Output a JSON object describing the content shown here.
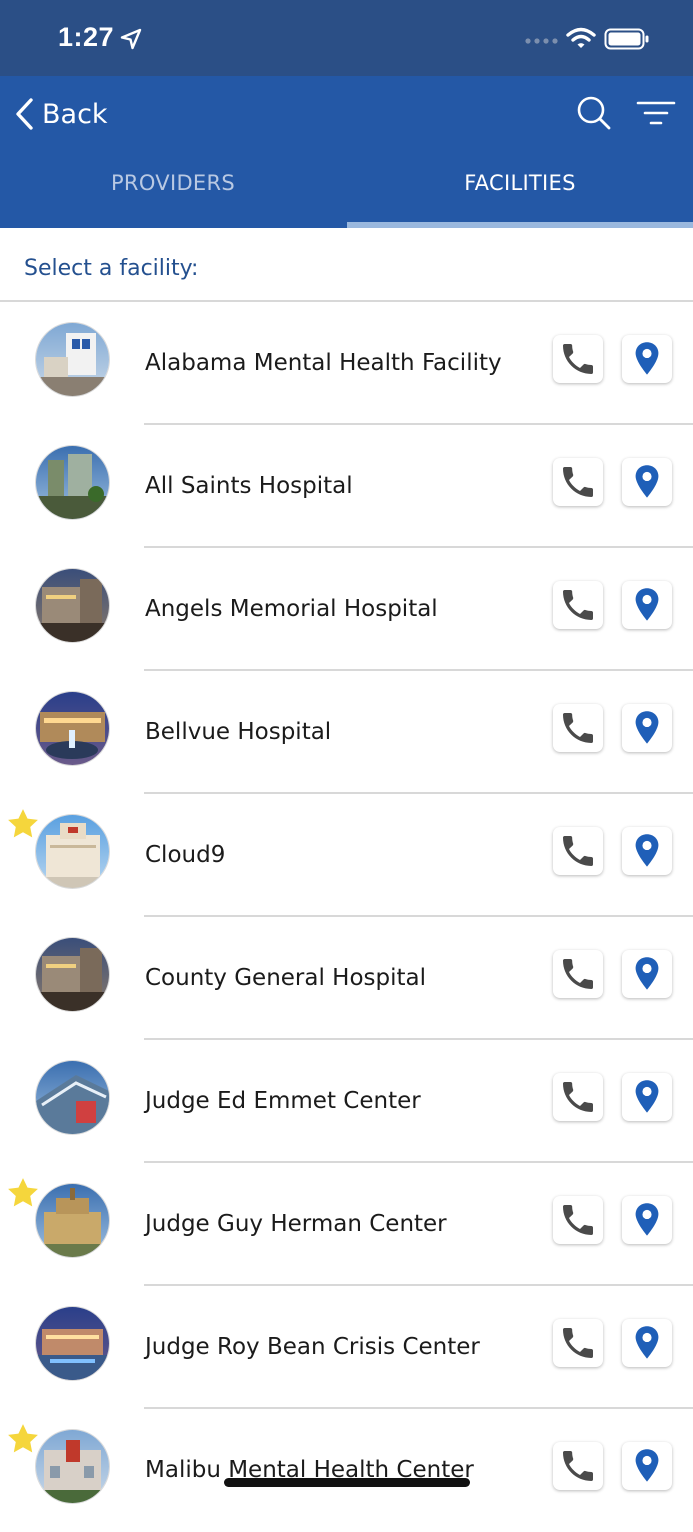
{
  "status_bar": {
    "time": "1:27"
  },
  "nav": {
    "back_label": "Back"
  },
  "tabs": [
    {
      "label": "PROVIDERS"
    },
    {
      "label": "FACILITIES"
    }
  ],
  "subheader": "Select a facility:",
  "facilities": [
    {
      "name": "Alabama Mental Health Facility",
      "favorite": false
    },
    {
      "name": "All Saints Hospital",
      "favorite": false
    },
    {
      "name": "Angels Memorial Hospital",
      "favorite": false
    },
    {
      "name": "Bellvue Hospital",
      "favorite": false
    },
    {
      "name": "Cloud9",
      "favorite": true
    },
    {
      "name": "County General Hospital",
      "favorite": false
    },
    {
      "name": "Judge Ed Emmet Center",
      "favorite": false
    },
    {
      "name": "Judge Guy Herman Center",
      "favorite": true
    },
    {
      "name": "Judge Roy Bean Crisis Center",
      "favorite": false
    },
    {
      "name": "Malibu Mental Health Center",
      "favorite": true
    }
  ],
  "icons": {
    "phone": "phone-icon",
    "map": "map-pin-icon",
    "favorite": "star-icon",
    "search": "search-icon",
    "filter": "filter-icon"
  },
  "colors": {
    "status_bar": "#2b4f86",
    "nav_bar": "#2458a6",
    "accent": "#24508f",
    "pin": "#1f5fb8",
    "star": "#f5d63c"
  }
}
